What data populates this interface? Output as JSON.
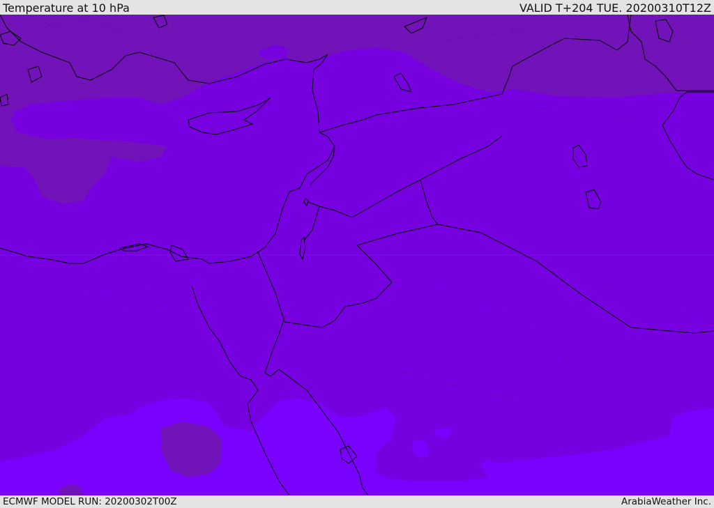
{
  "header": {
    "title": "Temperature at 10 hPa",
    "valid_time": "VALID T+204 TUE. 20200310T12Z"
  },
  "footer": {
    "model_run": "ECMWF MODEL RUN: 20200302T00Z",
    "credit": "ArabiaWeather Inc."
  },
  "map": {
    "field": "Temperature",
    "level": "10 hPa",
    "region": "Eastern Mediterranean / Middle East",
    "colors": {
      "cold_band": "#7113b8",
      "mid_band": "#7700e0",
      "warm_band": "#7a00ff",
      "coastline": "#000000"
    }
  }
}
